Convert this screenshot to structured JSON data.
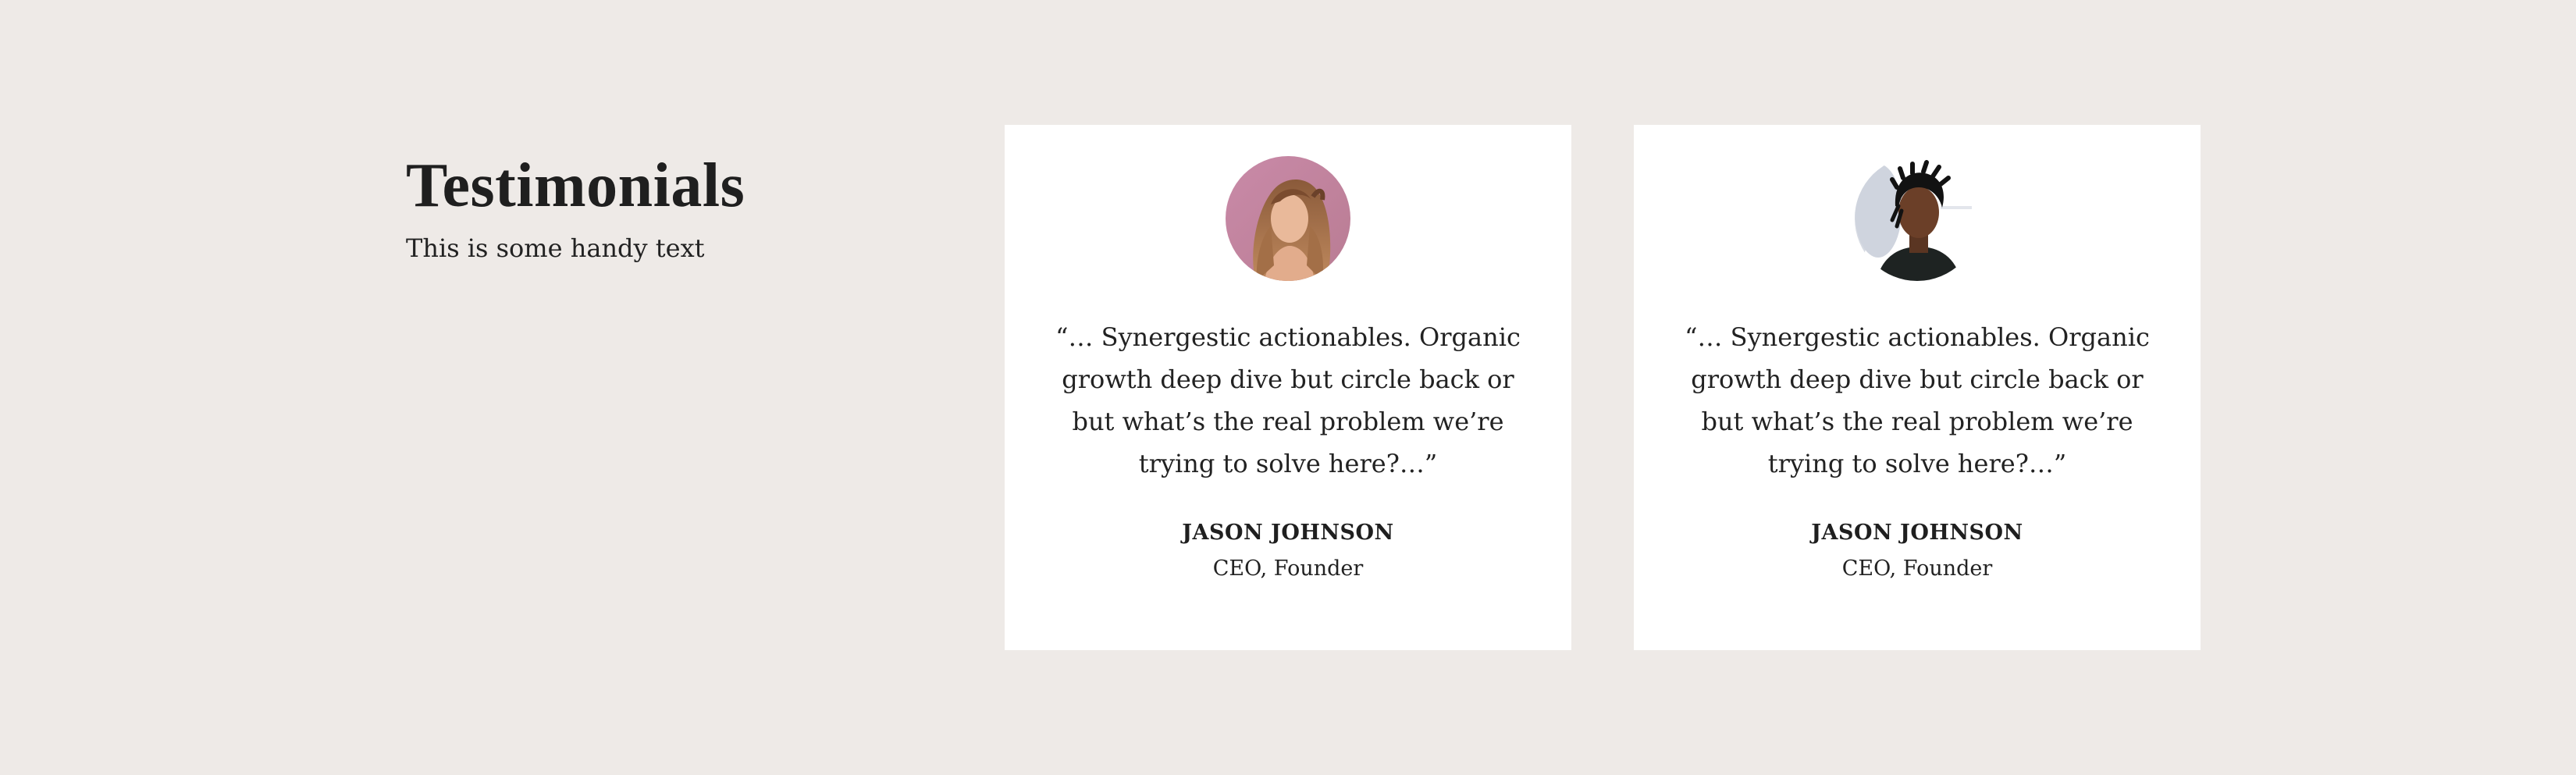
{
  "section": {
    "title": "Testimonials",
    "subtitle": "This is some handy text"
  },
  "testimonials": [
    {
      "quote": "“… Synergestic actionables. Organic growth deep dive but circle back or but what’s the real problem we’re trying to solve here?…”",
      "name": "JASON JOHNSON",
      "role": "CEO, Founder",
      "avatar": "woman-portrait"
    },
    {
      "quote": "“… Synergestic actionables. Organic growth deep dive but circle back or but what’s the real problem we’re trying to solve here?…”",
      "name": "JASON JOHNSON",
      "role": "CEO, Founder",
      "avatar": "man-portrait"
    }
  ],
  "colors": {
    "background": "#eeeae7",
    "card": "#ffffff",
    "text": "#1f1f1f"
  }
}
